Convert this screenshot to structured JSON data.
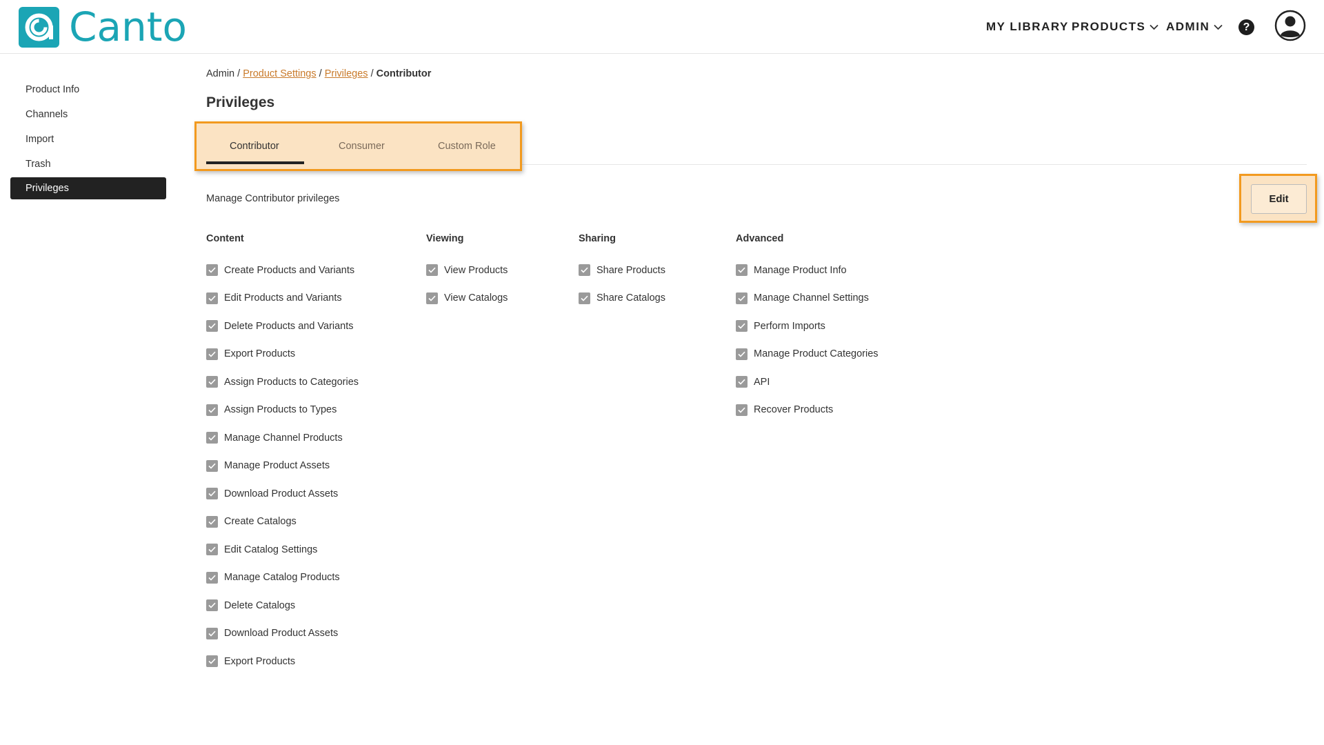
{
  "header": {
    "logo_text": "Canto",
    "nav": {
      "my_library": "MY LIBRARY",
      "products": "PRODUCTS",
      "admin": "ADMIN"
    },
    "help_label": "?"
  },
  "sidebar": {
    "items": [
      {
        "label": "Product Info"
      },
      {
        "label": "Channels"
      },
      {
        "label": "Import"
      },
      {
        "label": "Trash"
      },
      {
        "label": "Privileges"
      }
    ]
  },
  "breadcrumb": {
    "admin": "Admin",
    "sep": " / ",
    "product_settings": "Product Settings",
    "privileges": "Privileges",
    "current": "Contributor"
  },
  "page": {
    "title": "Privileges",
    "description": "Manage Contributor privileges",
    "edit_label": "Edit"
  },
  "tabs": [
    {
      "label": "Contributor",
      "active": true
    },
    {
      "label": "Consumer",
      "active": false
    },
    {
      "label": "Custom Role",
      "active": false
    }
  ],
  "privileges": {
    "content": {
      "heading": "Content",
      "items": [
        "Create Products and Variants",
        "Edit Products and Variants",
        "Delete Products and Variants",
        "Export Products",
        "Assign Products to Categories",
        "Assign Products to Types",
        "Manage Channel Products",
        "Manage Product Assets",
        "Download Product Assets",
        "Create Catalogs",
        "Edit Catalog Settings",
        "Manage Catalog Products",
        "Delete Catalogs",
        "Download Product Assets",
        "Export Products"
      ]
    },
    "viewing": {
      "heading": "Viewing",
      "items": [
        "View Products",
        "View Catalogs"
      ]
    },
    "sharing": {
      "heading": "Sharing",
      "items": [
        "Share Products",
        "Share Catalogs"
      ]
    },
    "advanced": {
      "heading": "Advanced",
      "items": [
        "Manage Product Info",
        "Manage Channel Settings",
        "Perform Imports",
        "Manage Product Categories",
        "API",
        "Recover Products"
      ]
    }
  },
  "colors": {
    "brand": "#1ba5b5",
    "highlight_border": "#f29a1f",
    "highlight_fill": "#fbe3c3",
    "link": "#c97a2a",
    "checkbox": "#9a9a9a"
  }
}
